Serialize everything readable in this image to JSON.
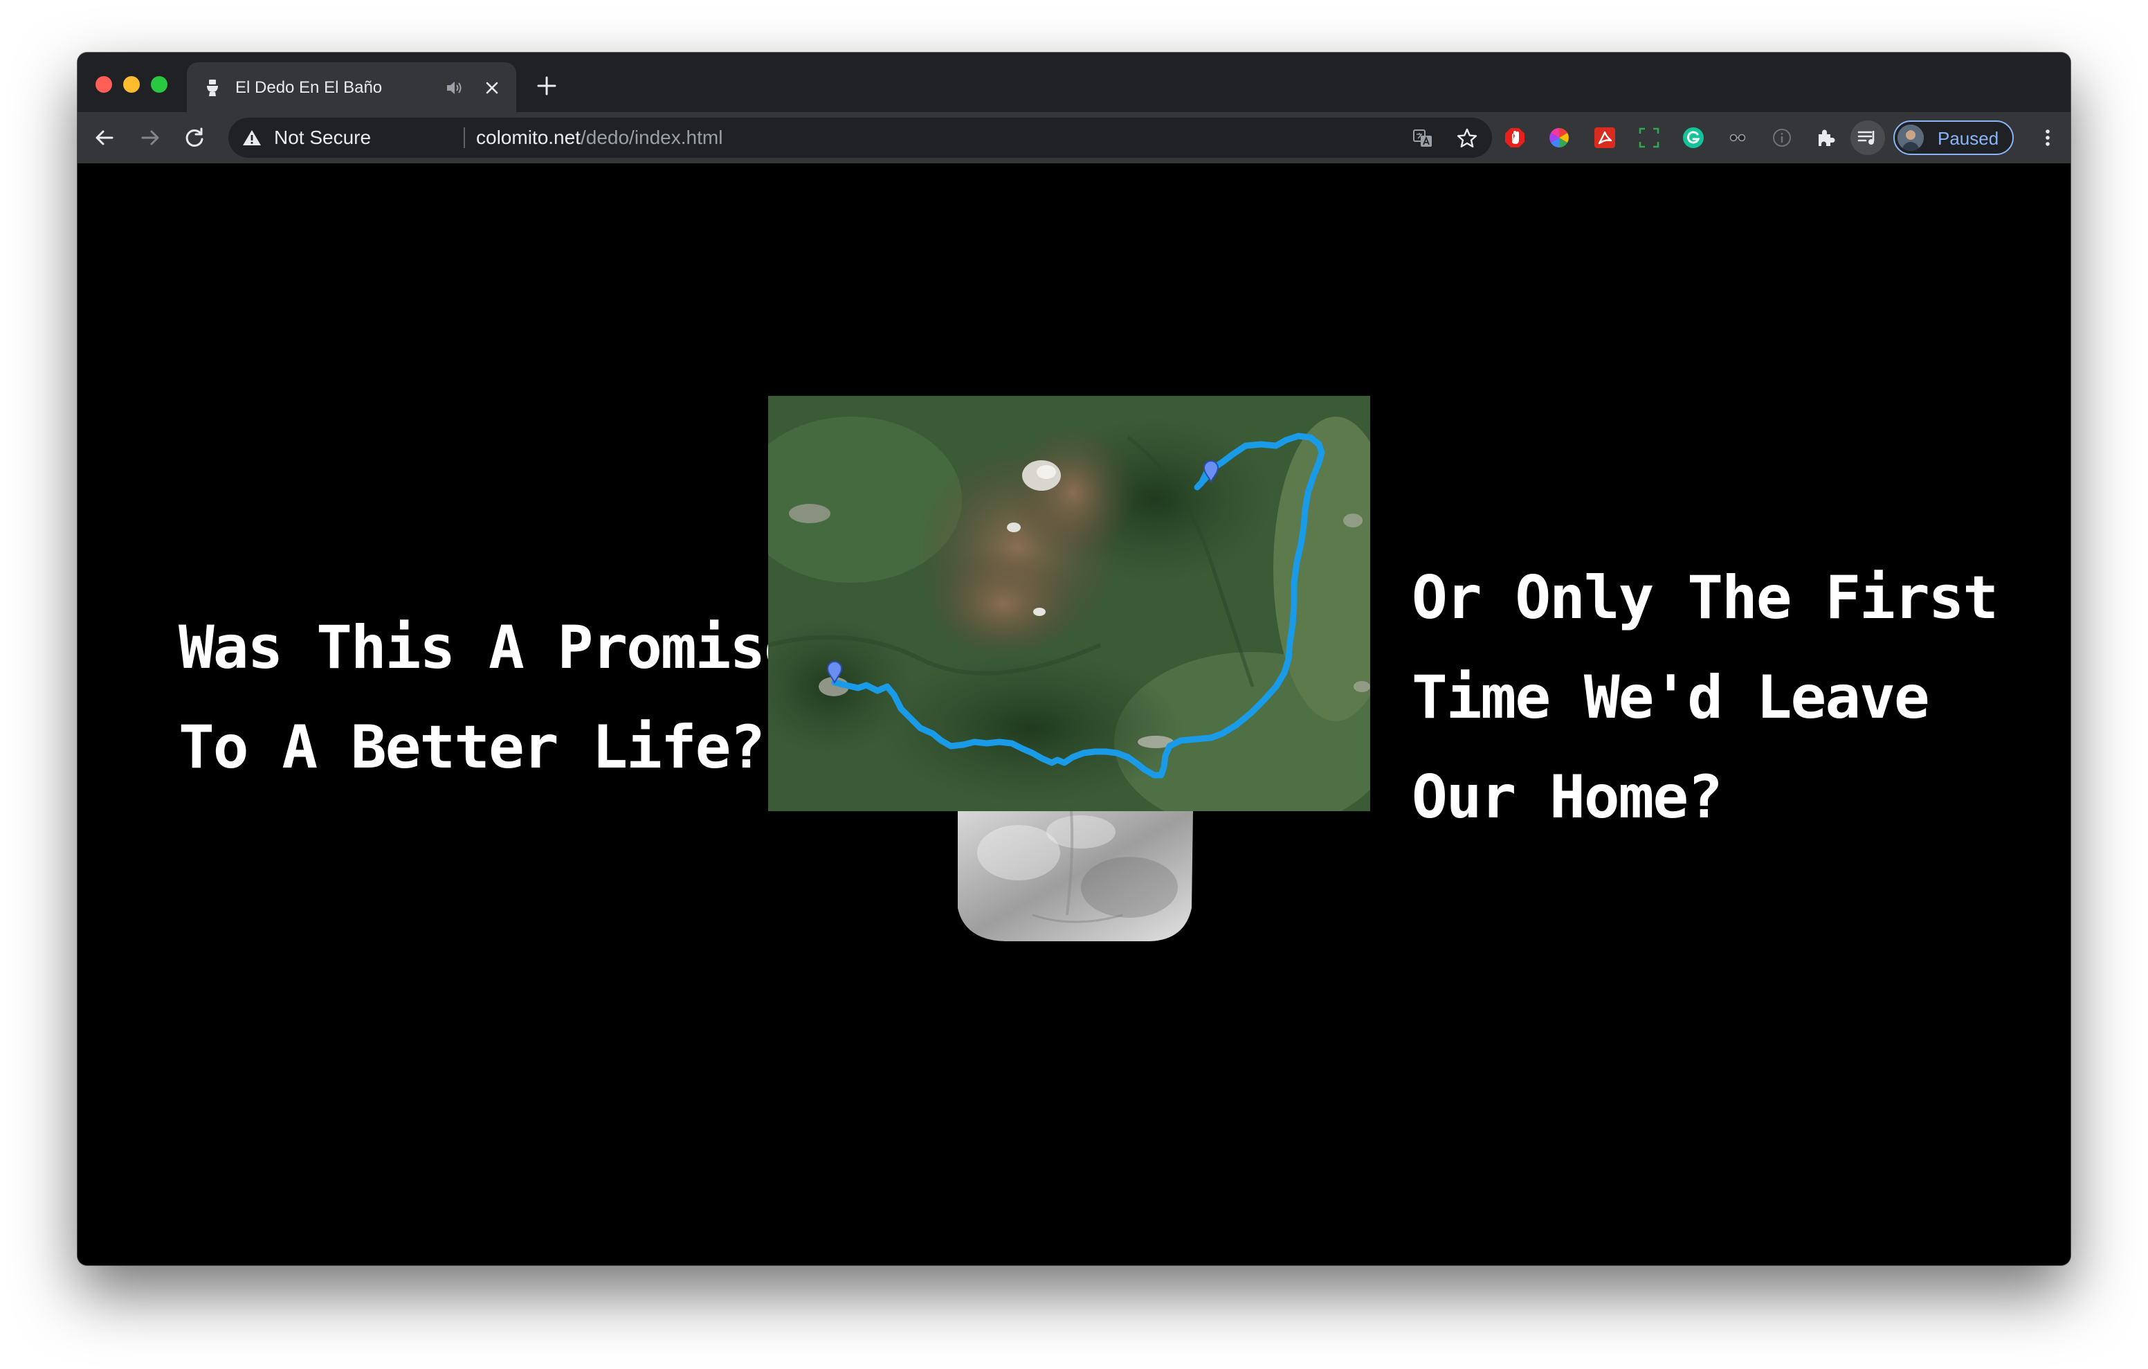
{
  "browser": {
    "tab": {
      "title": "El Dedo En El Baño",
      "favicon": "toilet-icon",
      "audio_icon": "speaker-icon",
      "close_icon": "close-icon"
    },
    "new_tab_icon": "plus-icon",
    "toolbar": {
      "back_icon": "back-arrow-icon",
      "forward_icon": "forward-arrow-icon",
      "reload_icon": "reload-icon",
      "security_label": "Not Secure",
      "url_host": "colomito.net",
      "url_path": "/dedo/index.html",
      "translate_icon": "translate-icon",
      "bookmark_icon": "star-icon",
      "extensions": [
        "adblock-icon",
        "color-wheel-icon",
        "acrobat-icon",
        "screenshot-icon",
        "grammarly-icon",
        "glasses-icon",
        "info-icon",
        "puzzle-icon",
        "media-queue-icon"
      ],
      "profile_label": "Paused",
      "menu_icon": "more-vert-icon"
    },
    "colors": {
      "tab_bar": "#202124",
      "toolbar": "#35363a",
      "route": "#1a9be8",
      "profile_accent": "#8ab4f8"
    }
  },
  "page": {
    "left_text": [
      "Was This A Promise",
      "To A Better Life?"
    ],
    "right_text": [
      "Or Only The First",
      "Time We'd Leave",
      "Our Home?"
    ],
    "image": {
      "type": "satellite-map-with-route",
      "markers": 2
    },
    "finger_image": "finger-tip"
  }
}
